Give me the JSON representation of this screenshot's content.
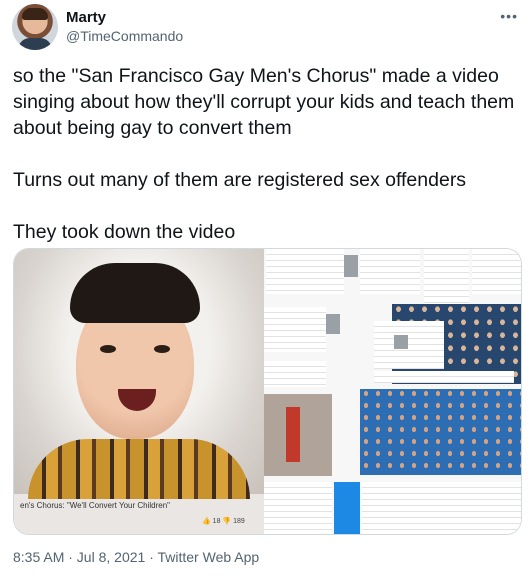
{
  "user": {
    "name": "Marty",
    "handle": "@TimeCommando"
  },
  "more_icon": "more-horizontal-icon",
  "tweet_text": "so the \"San Francisco Gay Men's Chorus\" made a video singing about how they'll corrupt your kids and teach them about being gay to convert them\n\nTurns out many of them are registered sex offenders\n\nThey took down the video",
  "media": {
    "video_caption": "en's Chorus: \"We'll Convert Your Children\"",
    "likes": "18",
    "dislikes": "189"
  },
  "footer": {
    "timestamp": "8:35 AM · Jul 8, 2021 · Twitter Web App"
  },
  "colors": {
    "text": "#0f1419",
    "secondary": "#536471",
    "border": "#cfd9de"
  }
}
